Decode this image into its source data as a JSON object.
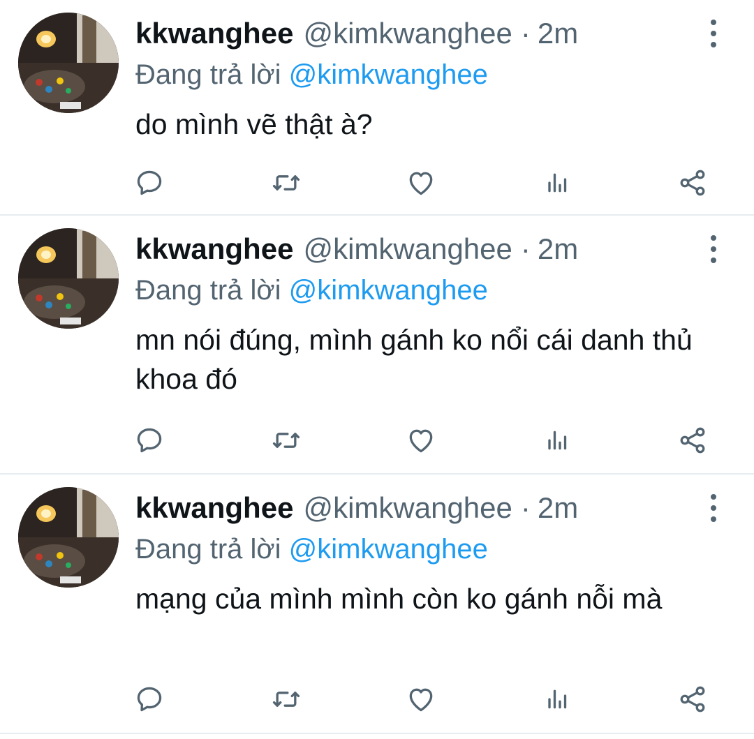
{
  "colors": {
    "text": "#0f1419",
    "secondary": "#536471",
    "link": "#1d9bf0",
    "divider": "#e6ecf0"
  },
  "icons": {
    "reply": "reply-icon",
    "retweet": "retweet-icon",
    "like": "heart-icon",
    "analytics": "analytics-icon",
    "share": "share-icon",
    "more": "more-vertical-icon"
  },
  "tweets": [
    {
      "display_name": "kkwanghee",
      "handle": "@kimkwanghee",
      "separator": "·",
      "time": "2m",
      "reply_prefix": "Đang trả lời",
      "reply_to": "@kimkwanghee",
      "text": "do mình vẽ thật à?"
    },
    {
      "display_name": "kkwanghee",
      "handle": "@kimkwanghee",
      "separator": "·",
      "time": "2m",
      "reply_prefix": "Đang trả lời",
      "reply_to": "@kimkwanghee",
      "text": "mn nói đúng, mình gánh ko nổi cái danh thủ khoa đó"
    },
    {
      "display_name": "kkwanghee",
      "handle": "@kimkwanghee",
      "separator": "·",
      "time": "2m",
      "reply_prefix": "Đang trả lời",
      "reply_to": "@kimkwanghee",
      "text": "mạng của mình mình còn ko gánh nỗi mà"
    }
  ]
}
